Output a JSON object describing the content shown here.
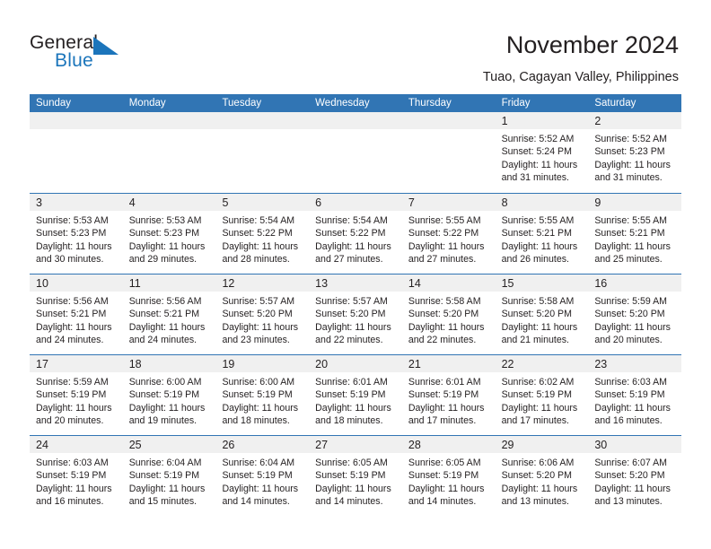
{
  "branding": {
    "logo_text_primary": "General",
    "logo_text_secondary": "Blue",
    "logo_mark": "triangle-icon",
    "primary_color": "#1b75bb",
    "header_color": "#3175b4",
    "day_band_color": "#f0f0f0"
  },
  "header": {
    "title": "November 2024",
    "subtitle": "Tuao, Cagayan Valley, Philippines"
  },
  "calendar": {
    "weekday_headers": [
      "Sunday",
      "Monday",
      "Tuesday",
      "Wednesday",
      "Thursday",
      "Friday",
      "Saturday"
    ],
    "weeks": [
      [
        {
          "day": "",
          "lines": []
        },
        {
          "day": "",
          "lines": []
        },
        {
          "day": "",
          "lines": []
        },
        {
          "day": "",
          "lines": []
        },
        {
          "day": "",
          "lines": []
        },
        {
          "day": "1",
          "lines": [
            "Sunrise: 5:52 AM",
            "Sunset: 5:24 PM",
            "Daylight: 11 hours",
            "and 31 minutes."
          ]
        },
        {
          "day": "2",
          "lines": [
            "Sunrise: 5:52 AM",
            "Sunset: 5:23 PM",
            "Daylight: 11 hours",
            "and 31 minutes."
          ]
        }
      ],
      [
        {
          "day": "3",
          "lines": [
            "Sunrise: 5:53 AM",
            "Sunset: 5:23 PM",
            "Daylight: 11 hours",
            "and 30 minutes."
          ]
        },
        {
          "day": "4",
          "lines": [
            "Sunrise: 5:53 AM",
            "Sunset: 5:23 PM",
            "Daylight: 11 hours",
            "and 29 minutes."
          ]
        },
        {
          "day": "5",
          "lines": [
            "Sunrise: 5:54 AM",
            "Sunset: 5:22 PM",
            "Daylight: 11 hours",
            "and 28 minutes."
          ]
        },
        {
          "day": "6",
          "lines": [
            "Sunrise: 5:54 AM",
            "Sunset: 5:22 PM",
            "Daylight: 11 hours",
            "and 27 minutes."
          ]
        },
        {
          "day": "7",
          "lines": [
            "Sunrise: 5:55 AM",
            "Sunset: 5:22 PM",
            "Daylight: 11 hours",
            "and 27 minutes."
          ]
        },
        {
          "day": "8",
          "lines": [
            "Sunrise: 5:55 AM",
            "Sunset: 5:21 PM",
            "Daylight: 11 hours",
            "and 26 minutes."
          ]
        },
        {
          "day": "9",
          "lines": [
            "Sunrise: 5:55 AM",
            "Sunset: 5:21 PM",
            "Daylight: 11 hours",
            "and 25 minutes."
          ]
        }
      ],
      [
        {
          "day": "10",
          "lines": [
            "Sunrise: 5:56 AM",
            "Sunset: 5:21 PM",
            "Daylight: 11 hours",
            "and 24 minutes."
          ]
        },
        {
          "day": "11",
          "lines": [
            "Sunrise: 5:56 AM",
            "Sunset: 5:21 PM",
            "Daylight: 11 hours",
            "and 24 minutes."
          ]
        },
        {
          "day": "12",
          "lines": [
            "Sunrise: 5:57 AM",
            "Sunset: 5:20 PM",
            "Daylight: 11 hours",
            "and 23 minutes."
          ]
        },
        {
          "day": "13",
          "lines": [
            "Sunrise: 5:57 AM",
            "Sunset: 5:20 PM",
            "Daylight: 11 hours",
            "and 22 minutes."
          ]
        },
        {
          "day": "14",
          "lines": [
            "Sunrise: 5:58 AM",
            "Sunset: 5:20 PM",
            "Daylight: 11 hours",
            "and 22 minutes."
          ]
        },
        {
          "day": "15",
          "lines": [
            "Sunrise: 5:58 AM",
            "Sunset: 5:20 PM",
            "Daylight: 11 hours",
            "and 21 minutes."
          ]
        },
        {
          "day": "16",
          "lines": [
            "Sunrise: 5:59 AM",
            "Sunset: 5:20 PM",
            "Daylight: 11 hours",
            "and 20 minutes."
          ]
        }
      ],
      [
        {
          "day": "17",
          "lines": [
            "Sunrise: 5:59 AM",
            "Sunset: 5:19 PM",
            "Daylight: 11 hours",
            "and 20 minutes."
          ]
        },
        {
          "day": "18",
          "lines": [
            "Sunrise: 6:00 AM",
            "Sunset: 5:19 PM",
            "Daylight: 11 hours",
            "and 19 minutes."
          ]
        },
        {
          "day": "19",
          "lines": [
            "Sunrise: 6:00 AM",
            "Sunset: 5:19 PM",
            "Daylight: 11 hours",
            "and 18 minutes."
          ]
        },
        {
          "day": "20",
          "lines": [
            "Sunrise: 6:01 AM",
            "Sunset: 5:19 PM",
            "Daylight: 11 hours",
            "and 18 minutes."
          ]
        },
        {
          "day": "21",
          "lines": [
            "Sunrise: 6:01 AM",
            "Sunset: 5:19 PM",
            "Daylight: 11 hours",
            "and 17 minutes."
          ]
        },
        {
          "day": "22",
          "lines": [
            "Sunrise: 6:02 AM",
            "Sunset: 5:19 PM",
            "Daylight: 11 hours",
            "and 17 minutes."
          ]
        },
        {
          "day": "23",
          "lines": [
            "Sunrise: 6:03 AM",
            "Sunset: 5:19 PM",
            "Daylight: 11 hours",
            "and 16 minutes."
          ]
        }
      ],
      [
        {
          "day": "24",
          "lines": [
            "Sunrise: 6:03 AM",
            "Sunset: 5:19 PM",
            "Daylight: 11 hours",
            "and 16 minutes."
          ]
        },
        {
          "day": "25",
          "lines": [
            "Sunrise: 6:04 AM",
            "Sunset: 5:19 PM",
            "Daylight: 11 hours",
            "and 15 minutes."
          ]
        },
        {
          "day": "26",
          "lines": [
            "Sunrise: 6:04 AM",
            "Sunset: 5:19 PM",
            "Daylight: 11 hours",
            "and 14 minutes."
          ]
        },
        {
          "day": "27",
          "lines": [
            "Sunrise: 6:05 AM",
            "Sunset: 5:19 PM",
            "Daylight: 11 hours",
            "and 14 minutes."
          ]
        },
        {
          "day": "28",
          "lines": [
            "Sunrise: 6:05 AM",
            "Sunset: 5:19 PM",
            "Daylight: 11 hours",
            "and 14 minutes."
          ]
        },
        {
          "day": "29",
          "lines": [
            "Sunrise: 6:06 AM",
            "Sunset: 5:20 PM",
            "Daylight: 11 hours",
            "and 13 minutes."
          ]
        },
        {
          "day": "30",
          "lines": [
            "Sunrise: 6:07 AM",
            "Sunset: 5:20 PM",
            "Daylight: 11 hours",
            "and 13 minutes."
          ]
        }
      ]
    ]
  }
}
